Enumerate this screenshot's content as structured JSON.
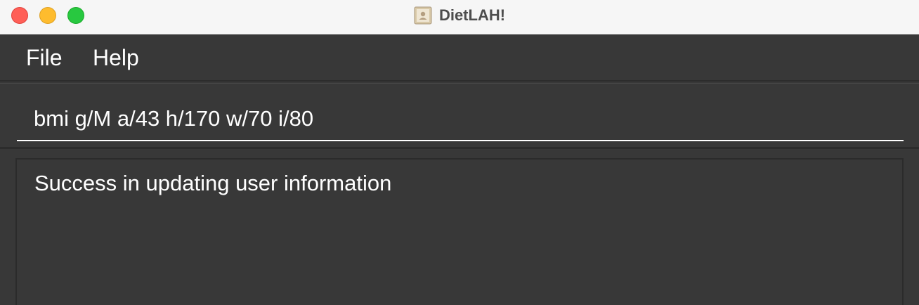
{
  "window": {
    "title": "DietLAH!",
    "controls": [
      "close-button",
      "minimize-button",
      "maximize-button"
    ]
  },
  "menubar": {
    "items": [
      {
        "label": "File"
      },
      {
        "label": "Help"
      }
    ]
  },
  "command_box": {
    "value": "bmi g/M a/43 h/170 w/70 i/80"
  },
  "result_display": {
    "text": "Success in updating user information"
  },
  "colors": {
    "background": "#383838",
    "titlebar": "#f6f6f6",
    "text": "#ffffff",
    "close": "#ff5f57",
    "minimize": "#febc2e",
    "maximize": "#28c840"
  },
  "icons": {
    "app": "contact-card-icon"
  }
}
